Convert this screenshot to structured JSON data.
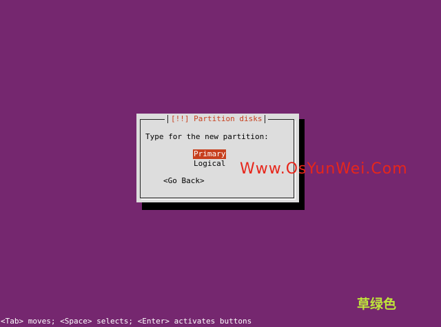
{
  "dialog": {
    "title": "[!!] Partition disks",
    "prompt": "Type for the new partition:",
    "options": [
      {
        "label": "Primary",
        "selected": true
      },
      {
        "label": "Logical",
        "selected": false
      }
    ],
    "back_label": "<Go Back>"
  },
  "footer": {
    "help_text": "<Tab> moves; <Space> selects; <Enter> activates buttons"
  },
  "overlay": {
    "watermark": "Www.OsYunWei.Com",
    "signature": "草绿色"
  },
  "colors": {
    "background": "#75276f",
    "dialog_bg": "#dddddd",
    "accent": "#c7401e",
    "watermark": "#e7261b",
    "signature": "#bfe63a"
  }
}
